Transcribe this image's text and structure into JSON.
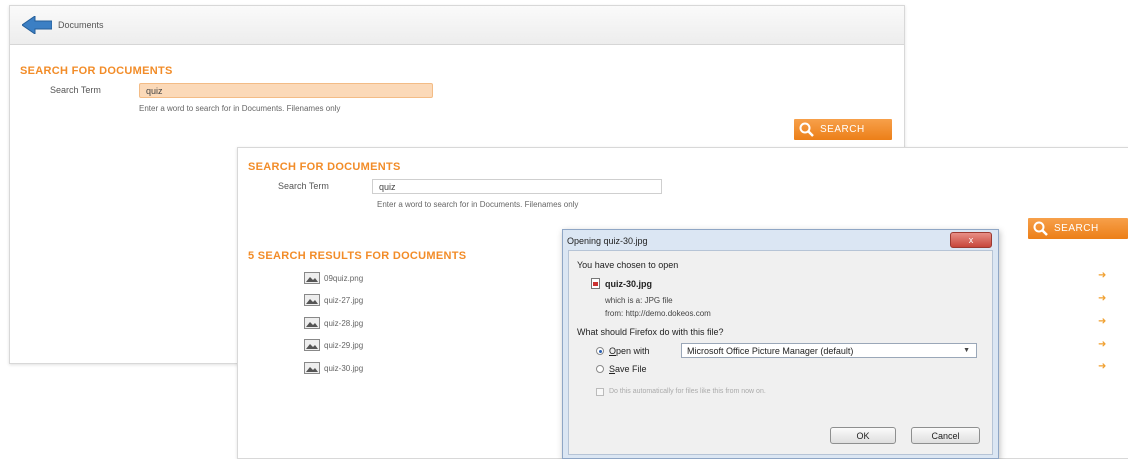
{
  "back_panel": {
    "topbar_label": "Documents",
    "section_title": "SEARCH FOR DOCUMENTS",
    "search_label": "Search Term",
    "search_value": "quiz",
    "hint": "Enter a word to search for in Documents. Filenames only",
    "search_button": "SEARCH"
  },
  "front_panel": {
    "section_title": "SEARCH FOR DOCUMENTS",
    "search_label": "Search Term",
    "search_value": "quiz",
    "hint": "Enter a word to search for in Documents. Filenames only",
    "search_button": "SEARCH",
    "results_title": "5 SEARCH RESULTS FOR DOCUMENTS",
    "results": [
      {
        "name": "09quiz.png"
      },
      {
        "name": "quiz-27.jpg"
      },
      {
        "name": "quiz-28.jpg"
      },
      {
        "name": "quiz-29.jpg"
      },
      {
        "name": "quiz-30.jpg"
      }
    ]
  },
  "dialog": {
    "title": "Opening quiz-30.jpg",
    "close_label": "x",
    "chosen_text": "You have chosen to open",
    "file_name": "quiz-30.jpg",
    "which_is": "which is a: JPG file",
    "from": "from: http://demo.dokeos.com",
    "question": "What should Firefox do with this file?",
    "open_with_prefix": "O",
    "open_with_rest": "pen with",
    "open_with_app": "Microsoft Office Picture Manager (default)",
    "save_prefix": "S",
    "save_rest": "ave File",
    "auto_text": "Do this automatically for files like this from now on.",
    "ok": "OK",
    "cancel": "Cancel"
  },
  "colors": {
    "accent_orange": "#f28c28",
    "input_highlight": "#fbd9b8",
    "dialog_frame": "#dbe6f3"
  }
}
